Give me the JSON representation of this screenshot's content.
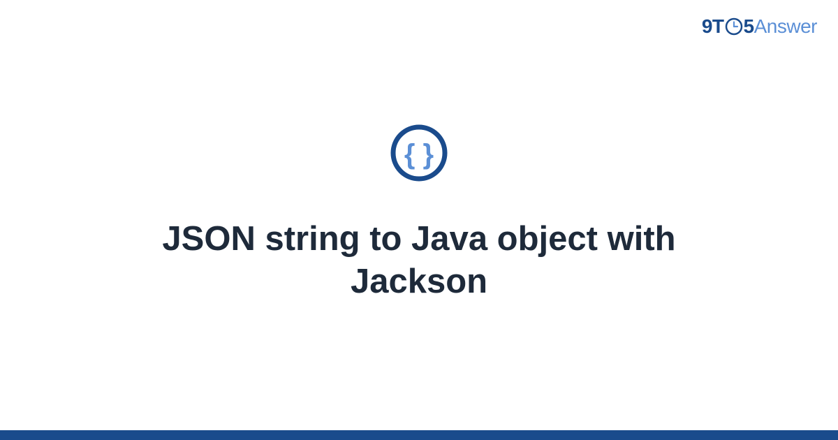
{
  "header": {
    "logo": {
      "part1": "9T",
      "part2": "5",
      "part3": "Answer"
    }
  },
  "main": {
    "icon_name": "json-braces-icon",
    "title": "JSON string to Java object with Jackson"
  },
  "colors": {
    "primary": "#1a4b8c",
    "accent": "#5b8fd6",
    "icon_ring": "#1a4b8c",
    "icon_braces": "#5b8fd6"
  }
}
